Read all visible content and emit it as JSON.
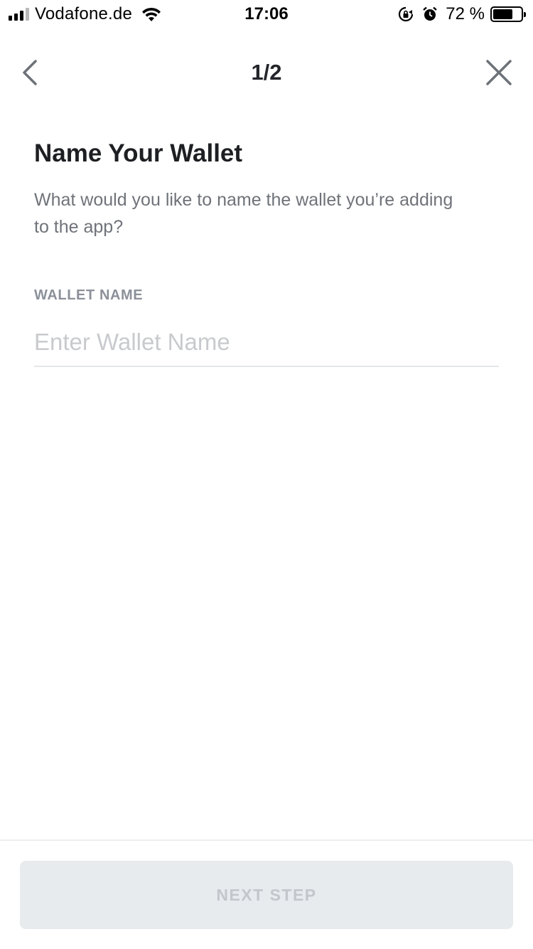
{
  "status_bar": {
    "carrier": "Vodafone.de",
    "time": "17:06",
    "battery_percent": "72 %",
    "battery_level": 0.72,
    "icons": [
      "signal-icon",
      "wifi-icon",
      "rotation-lock-icon",
      "alarm-icon",
      "battery-icon"
    ]
  },
  "nav": {
    "step": "1/2",
    "back_icon": "chevron-left-icon",
    "close_icon": "close-icon"
  },
  "content": {
    "title": "Name Your Wallet",
    "subtitle": "What would you like to name the wallet you’re adding to the app?"
  },
  "form": {
    "wallet_name_label": "WALLET NAME",
    "wallet_name_placeholder": "Enter Wallet Name",
    "wallet_name_value": ""
  },
  "footer": {
    "next_label": "NEXT STEP",
    "next_enabled": false
  },
  "colors": {
    "title": "#1e1f23",
    "subtitle": "#6f7379",
    "label": "#8b9099",
    "placeholder": "#c8cacd",
    "button_disabled_bg": "#e8ebee",
    "button_disabled_text": "#c3c7cc"
  }
}
